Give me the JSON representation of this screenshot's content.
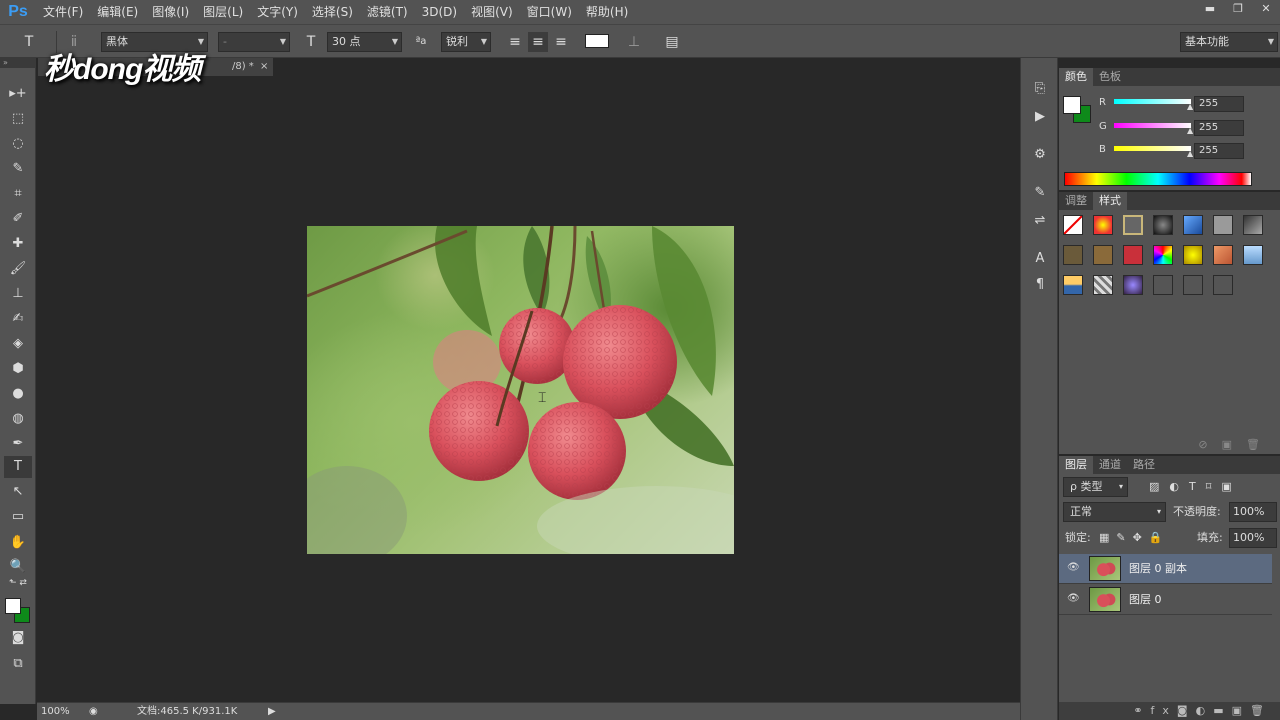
{
  "app": {
    "logo": "Ps"
  },
  "menu": [
    "文件(F)",
    "编辑(E)",
    "图像(I)",
    "图层(L)",
    "文字(Y)",
    "选择(S)",
    "滤镜(T)",
    "3D(D)",
    "视图(V)",
    "窗口(W)",
    "帮助(H)"
  ],
  "window_controls": {
    "minimize": "▬",
    "restore": "❐",
    "close": "✕"
  },
  "options": {
    "tool_glyph": "T",
    "font_family": "黑体",
    "font_style": "-",
    "font_size": "30 点",
    "aa_label": "ªa",
    "antialias": "锐利",
    "workspace": "基本功能"
  },
  "watermark": "秒dong视频",
  "document": {
    "tab_suffix": "/8) *",
    "close": "×"
  },
  "status": {
    "zoom": "100%",
    "doc_info": "文档:465.5 K/931.1K"
  },
  "tools": [
    "▸+",
    "⬚",
    "◌",
    "✎",
    "⌗",
    "✐",
    "✚",
    "🖌",
    "⊥",
    "✍",
    "◈",
    "⬢",
    "●",
    "◍",
    "✒",
    "T",
    "↖",
    "▭",
    "✋",
    "🔍"
  ],
  "color_panel": {
    "tabs": [
      "颜色",
      "色板"
    ],
    "r_label": "R",
    "g_label": "G",
    "b_label": "B",
    "r": "255",
    "g": "255",
    "b": "255",
    "fg_color": "#ffffff",
    "bg_color": "#0e8a1a"
  },
  "style_panel": {
    "tabs": [
      "调整",
      "样式"
    ]
  },
  "layers_panel": {
    "tabs": [
      "图层",
      "通道",
      "路径"
    ],
    "filter": "ρ 类型",
    "blend_mode": "正常",
    "opacity_label": "不透明度:",
    "opacity": "100%",
    "lock_label": "锁定:",
    "fill_label": "填充:",
    "fill": "100%",
    "layers": [
      {
        "name": "图层 0 副本",
        "selected": true
      },
      {
        "name": "图层 0",
        "selected": false
      }
    ]
  }
}
